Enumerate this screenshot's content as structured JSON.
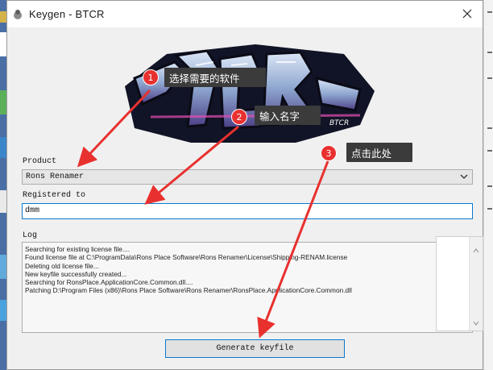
{
  "window": {
    "title": "Keygen - BTCR"
  },
  "banner": {
    "logo_text": "BTCR",
    "small_tag": "BTCR"
  },
  "form": {
    "product_label": "Product",
    "product_value": "Rons Renamer",
    "registered_label": "Registered to",
    "registered_value": "dmm",
    "log_label": "Log",
    "log_lines": [
      "Searching for existing license file....",
      "Found license file at C:\\ProgramData\\Rons Place Software\\Rons Renamer\\License\\Shipping-RENAM.license",
      "Deleting old license file...",
      "New keyfile successfully created...",
      "Searching for RonsPlace.ApplicationCore.Common.dll....",
      "Patching D:\\Program Files (x86)\\Rons Place Software\\Rons Renamer\\RonsPlace.ApplicationCore.Common.dll"
    ],
    "generate_label": "Generate keyfile"
  },
  "annotations": [
    {
      "number": "1",
      "text": "选择需要的软件"
    },
    {
      "number": "2",
      "text": "输入名字"
    },
    {
      "number": "3",
      "text": "点击此处"
    }
  ],
  "colors": {
    "annotation_red": "#e8312f",
    "callout_bg": "#3b3b3b",
    "focus_blue": "#0b79d0"
  }
}
